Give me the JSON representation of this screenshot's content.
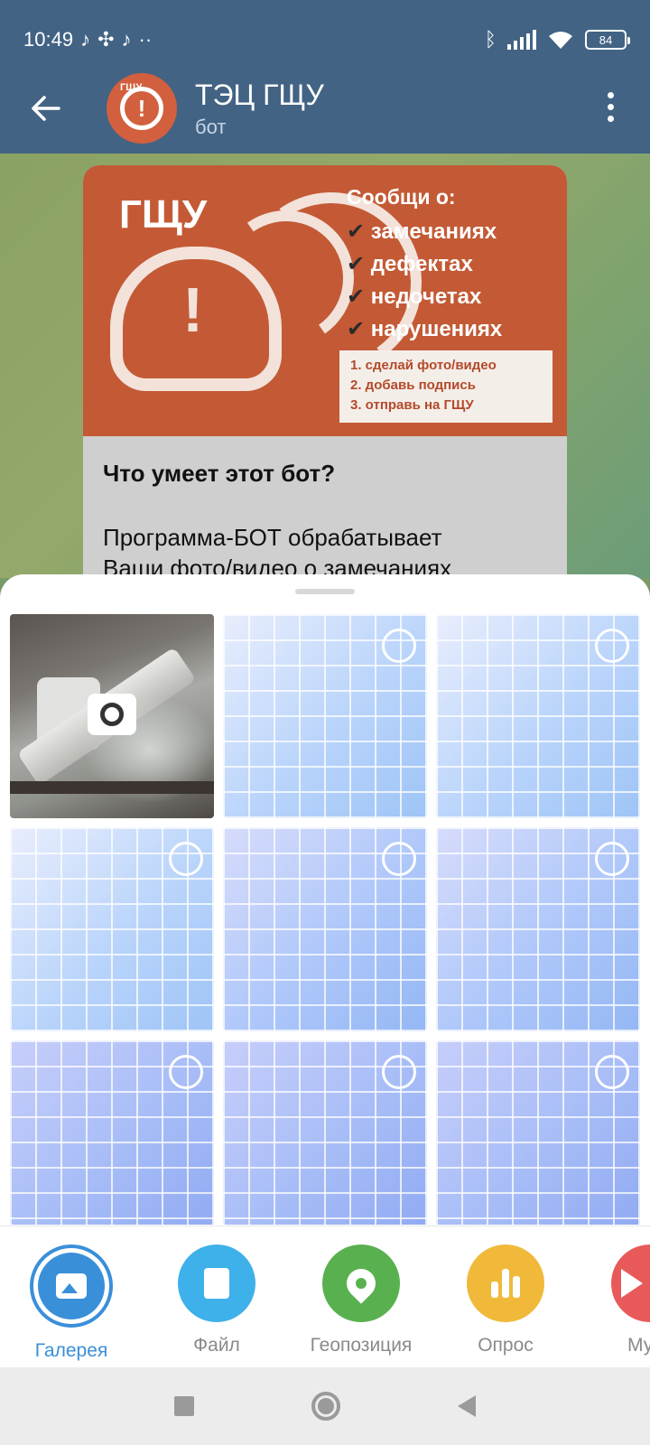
{
  "status_bar": {
    "time": "10:49",
    "notification_icons": [
      "tiktok-icon",
      "pinwheel-icon",
      "tiktok-icon"
    ],
    "more": "··",
    "battery": "84"
  },
  "header": {
    "back_icon": "arrow-left-icon",
    "avatar_label": "ГЩУ",
    "title": "ТЭЦ ГЩУ",
    "subtitle": "бот",
    "menu_icon": "more-vertical-icon"
  },
  "message": {
    "poster": {
      "brand": "ГЩУ",
      "heading": "Сообщи о:",
      "items": [
        "замечаниях",
        "дефектах",
        "недочетах",
        "нарушениях"
      ],
      "steps": [
        "1. сделай фото/видео",
        "2. добавь подпись",
        "3. отправь на ГЩУ"
      ]
    },
    "heading": "Что умеет этот бот?",
    "body_line1": "Программа-БОТ обрабатывает",
    "body_line2": "Ваши фото/видео о замечаниях"
  },
  "gallery": {
    "camera_icon": "camera-icon",
    "select_icon": "circle-select-icon"
  },
  "attach_bar": {
    "items": [
      {
        "label": "Галерея",
        "color": "#3a8fd9",
        "icon": "image-icon",
        "active": true
      },
      {
        "label": "Файл",
        "color": "#3eb0ea",
        "icon": "file-icon"
      },
      {
        "label": "Геопозиция",
        "color": "#59b04f",
        "icon": "location-pin-icon"
      },
      {
        "label": "Опрос",
        "color": "#f0b93a",
        "icon": "poll-icon"
      },
      {
        "label": "Муз",
        "color": "#e85a5a",
        "icon": "music-icon"
      }
    ]
  },
  "colors": {
    "header_bg": "#426384",
    "accent": "#3a8fd9"
  }
}
